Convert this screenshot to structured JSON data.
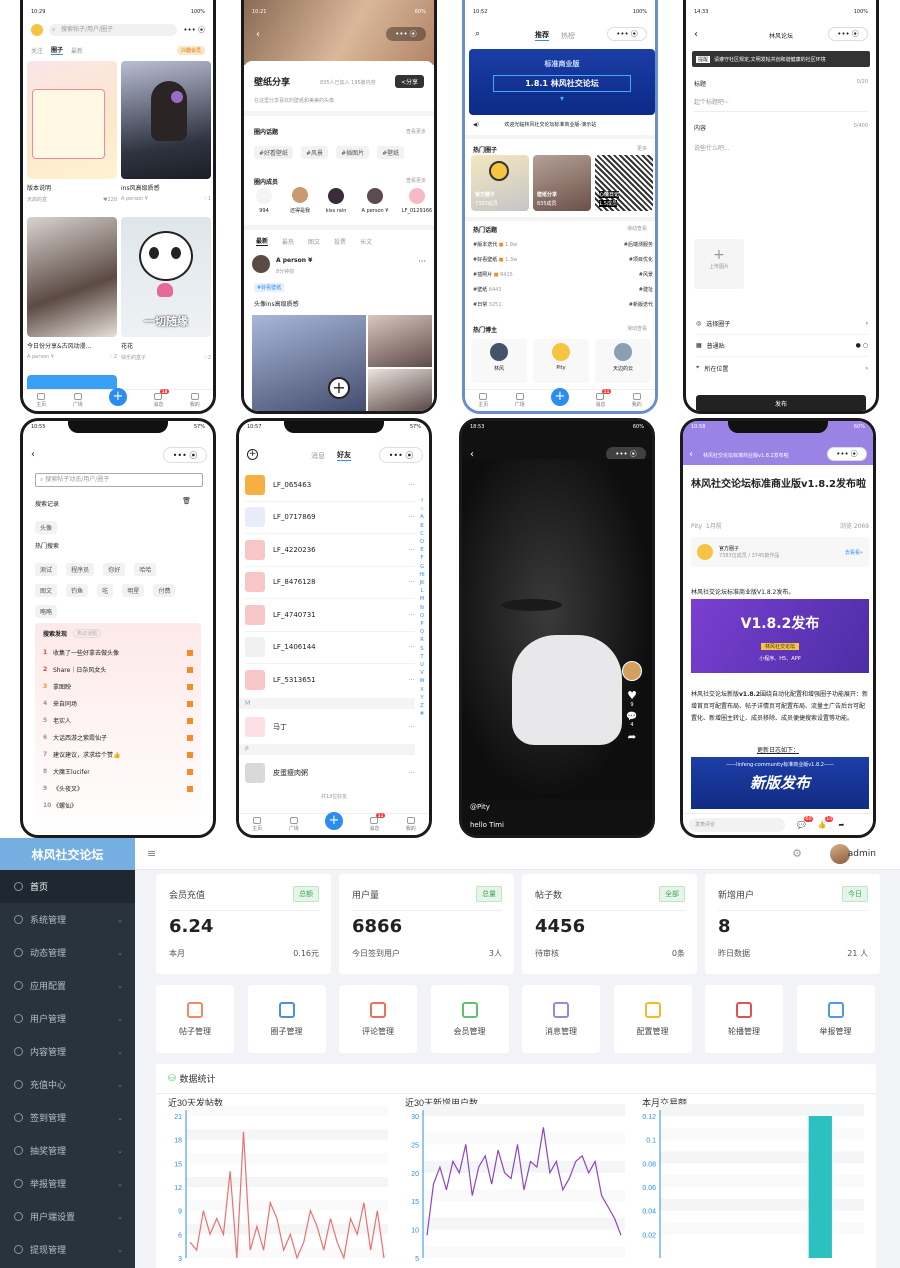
{
  "phones": {
    "p1": {
      "time": "10:29",
      "battery": "100%",
      "search": "搜索帖子/用户/圈子",
      "tabs": [
        "关注",
        "圈子",
        "最新"
      ],
      "promo": "兴趣会员",
      "cards": [
        {
          "title": "版本说明",
          "user": "天启的盒",
          "likes": "228"
        },
        {
          "title": "ins风高级质感",
          "user": "A person ¥",
          "likes": "1"
        },
        {
          "title": "今日份分享&古风动漫...",
          "user": "A person ¥",
          "likes": "2"
        },
        {
          "title": "花花",
          "user": "快乐的盒子",
          "likes": "2"
        }
      ],
      "panda_text": "一切随缘",
      "tabbar": [
        "主页",
        "广场",
        "",
        "消息",
        "我的"
      ],
      "msg_badge": "18"
    },
    "p2": {
      "time": "10:21",
      "battery": "60%",
      "title": "壁纸分享",
      "stats": "835人已加入 195篇内容",
      "share": "<分享",
      "desc": "在这里分享喜欢的壁纸和美美的头像",
      "hot_topics": "圈内话题",
      "more": "查看更多",
      "topics": [
        "#好看壁纸",
        "#风景",
        "#插图片",
        "#壁纸"
      ],
      "members_title": "圈内成员",
      "members": [
        "994",
        "还得是我",
        "kiss rain",
        "A person ¥",
        "LF_0129166"
      ],
      "subtabs": [
        "最新",
        "最热",
        "图文",
        "投票",
        "长文"
      ],
      "post_user": "A person ¥",
      "post_time": "8分钟前",
      "post_tag": "#好看壁纸",
      "post_text": "头像ins高级质感"
    },
    "p3": {
      "time": "10:52",
      "battery": "100%",
      "tabs": [
        "推荐",
        "热榜"
      ],
      "banner_title": "标准商业版",
      "banner_ver": "1.8.1 林风社交论坛",
      "notice": "欢迎光临林风社交论坛标准商业版-演示站",
      "hot_circles": "热门圈子",
      "more": "更多",
      "circles": [
        {
          "name": "官方圈子",
          "sub": "7383成员"
        },
        {
          "name": "壁纸分享",
          "sub": "835成员"
        },
        {
          "name": "心情日记",
          "sub": "1.5成员"
        }
      ],
      "hot_topics": "热门话题",
      "topics_more": "滑动查看",
      "topics": [
        {
          "l": "#版本迭代",
          "lv": "1.8w",
          "r": "#后端测服务"
        },
        {
          "l": "#好看壁纸",
          "lv": "1.3w",
          "r": "#项目优化"
        },
        {
          "l": "#插照片",
          "lv": "8415",
          "r": "#风景"
        },
        {
          "l": "#壁纸",
          "lv": "6443",
          "r": "#建址"
        },
        {
          "l": "#日常",
          "lv": "3251",
          "r": "#新版迭代"
        }
      ],
      "hot_hosts": "热门博主",
      "hosts_more": "滑动查看",
      "hosts": [
        "林风",
        "Pity",
        "天边的云"
      ],
      "tabbar": [
        "主页",
        "广场",
        "",
        "消息",
        "我的"
      ],
      "msg_badge": "11"
    },
    "p4": {
      "time": "14:33",
      "battery": "100%",
      "title": "林风论坛",
      "tip": "请遵守社区规定,文明发帖共创和谐健康的社区环境",
      "tip_tag": "提醒",
      "label_title": "标题",
      "count_title": "0/20",
      "ph_title": "起个标题吧~",
      "label_content": "内容",
      "count_content": "0/400",
      "ph_content": "说些什么吧...",
      "upload": "上传图片",
      "opts": [
        "选择圈子",
        "普通贴",
        "所在位置"
      ],
      "submit": "发布"
    },
    "p5": {
      "time": "10:55",
      "battery": "57%",
      "search": "搜索帖子动态/用户/圈子",
      "history_title": "搜索记录",
      "history": [
        "头像"
      ],
      "hot_title": "热门搜索",
      "hot": [
        "测试",
        "程序员",
        "你好",
        "哈哈",
        "图文",
        "钓鱼",
        "吃",
        "明星",
        "付费",
        "略略"
      ],
      "discover_title": "搜索发现",
      "discover_tag": "热议话题",
      "discover": [
        "收集了一些好拿去做头像",
        "Share｜日杂风女头",
        "拿图映",
        "来自同场",
        "老实人",
        "大话西游之紫霞仙子",
        "建议建议，求求给个赞👍",
        "大魔王lucifer",
        "《头夜叉》",
        "《螺仙》"
      ]
    },
    "p6": {
      "time": "10:57",
      "battery": "57%",
      "tabs": [
        "消息",
        "好友"
      ],
      "friends": [
        "LF_065463",
        "LF_0717869",
        "LF_4220236",
        "LF_8476128",
        "LF_4740731",
        "LF_1406144",
        "LF_5313651"
      ],
      "group_m": "M",
      "friend_m": "马丁",
      "group_p": "P",
      "friend_p": "皮蛋瘦肉粥",
      "total": "共13位好友",
      "index": "↑☆ABCDEFGHIJKLMNOPQRSTUVWXYZ#",
      "tabbar": [
        "主页",
        "广场",
        "",
        "消息",
        "我的"
      ],
      "msg_badge": "11"
    },
    "p7": {
      "time": "18:53",
      "battery": "60%",
      "user": "@Pity",
      "caption": "hello Timi",
      "likes": "9",
      "comments": "4"
    },
    "p8": {
      "time": "10:58",
      "battery": "60%",
      "header": "林风社交论坛标准商业版v1.8.2发布啦",
      "title": "林风社交论坛标准商业版v1.8.2发布啦",
      "author": "Pity",
      "ago": "1月前",
      "views": "浏览 2069",
      "circle": "官方圈子",
      "circle_sub": "7383位成员 / 3745篇作品",
      "circle_link": "去看看»",
      "intro": "林风社交论坛标准商业版V1.8.2发布。",
      "img_title": "V1.8.2发布",
      "img_sub": "林风社交论坛",
      "img_plat": "小程序、H5、APP",
      "body1": "林风社交论坛新版",
      "body_bold": "v1.8.2",
      "body2": "围绕自动化配置和增强圈子功能展开：新增首页可配置布局、帖子详情页可配置布局、流量主广告后台可配置化、新增圈主转让、成员移除、成员便捷搜索设置等功能。",
      "update_link": "更新日志如下：",
      "img2_top": "——linfeng-community标准商业版v1.8.2——",
      "img2_title": "新版发布",
      "comment_ph": "发表评论",
      "c1": "60",
      "c2": "10"
    }
  },
  "admin": {
    "brand": "林风社交论坛",
    "user": "admin",
    "menu": [
      "首页",
      "系统管理",
      "动态管理",
      "应用配置",
      "用户管理",
      "内容管理",
      "充值中心",
      "签到管理",
      "抽奖管理",
      "举报管理",
      "用户端设置",
      "提现管理"
    ],
    "stats": [
      {
        "title": "会员充值",
        "badge": "总额",
        "value": "6.24",
        "bl": "本月",
        "br": "0.16元"
      },
      {
        "title": "用户量",
        "badge": "总量",
        "value": "6866",
        "bl": "今日签到用户",
        "br": "3人"
      },
      {
        "title": "帖子数",
        "badge": "全部",
        "value": "4456",
        "bl": "待审核",
        "br": "0条"
      },
      {
        "title": "新增用户",
        "badge": "今日",
        "value": "8",
        "bl": "昨日数据",
        "br": "21 人"
      }
    ],
    "quick": [
      {
        "label": "帖子管理",
        "icon": "mail-icon",
        "color": "#f5895f"
      },
      {
        "label": "圈子管理",
        "icon": "file-icon",
        "color": "#4b8ee8"
      },
      {
        "label": "评论管理",
        "icon": "image-icon",
        "color": "#f06c5b"
      },
      {
        "label": "会员管理",
        "icon": "user-card-icon",
        "color": "#5cc272"
      },
      {
        "label": "消息管理",
        "icon": "bell-icon",
        "color": "#9a86e0"
      },
      {
        "label": "配置管理",
        "icon": "question-icon",
        "color": "#f3b82f"
      },
      {
        "label": "轮播管理",
        "icon": "printer-icon",
        "color": "#e05252"
      },
      {
        "label": "举报管理",
        "icon": "bag-icon",
        "color": "#4b9ae8"
      }
    ],
    "panel_title": "数据统计"
  },
  "chart_data": [
    {
      "type": "line",
      "title": "近30天发帖数",
      "color": "#ef6f6f",
      "ylim": [
        3,
        21
      ],
      "yticks": [
        3,
        6,
        9,
        12,
        15,
        18,
        21
      ],
      "values": [
        5,
        4,
        9,
        6,
        8,
        6,
        14,
        3,
        19,
        4,
        7,
        4,
        10,
        8,
        4,
        6,
        3,
        5,
        9,
        7,
        4,
        8,
        5,
        3,
        8,
        6,
        10,
        4,
        9,
        3
      ]
    },
    {
      "type": "line",
      "title": "近30天新增用户数",
      "color": "#8e44c4",
      "ylim": [
        5,
        30
      ],
      "yticks": [
        5,
        10,
        15,
        20,
        25,
        30
      ],
      "values": [
        9,
        18,
        21,
        17,
        22,
        20,
        25,
        16,
        21,
        23,
        18,
        24,
        20,
        19,
        25,
        17,
        22,
        21,
        28,
        20,
        22,
        17,
        19,
        22,
        23,
        20,
        22,
        16,
        14,
        12,
        9
      ]
    },
    {
      "type": "bar",
      "title": "本月交易额",
      "color": "#2bc1c1",
      "ylim": [
        0,
        0.12
      ],
      "yticks": [
        0.02,
        0.04,
        0.06,
        0.08,
        0.1,
        0.12
      ],
      "values": [
        0,
        0,
        0,
        0,
        0,
        0.12,
        0
      ]
    }
  ]
}
